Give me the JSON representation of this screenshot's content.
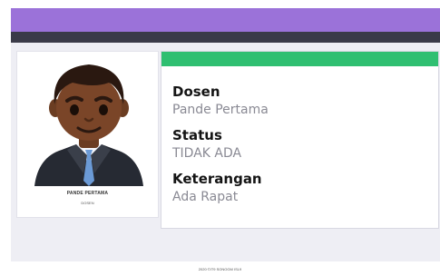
{
  "header": {
    "accent_color": "#9b72d9",
    "nav_color": "#3a3a48"
  },
  "profile": {
    "avatar_icon": "man-avatar-icon",
    "name": "PANDE PERTAMA",
    "role": "DOSEN"
  },
  "info": {
    "header_color": "#2fbf71",
    "fields": [
      {
        "label": "Dosen",
        "value": "Pande Pertama"
      },
      {
        "label": "Status",
        "value": "TIDAK ADA"
      },
      {
        "label": "Keterangan",
        "value": "Ada Rapat"
      }
    ]
  },
  "footer": {
    "text": "2020 ©IT9 SONOGM ISL9"
  }
}
